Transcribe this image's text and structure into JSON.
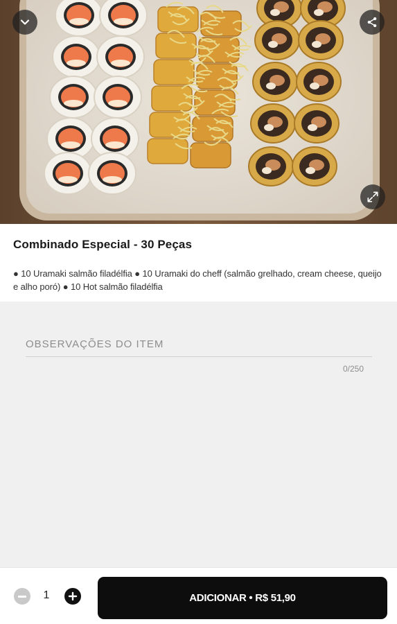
{
  "product": {
    "title": "Combinado Especial - 30 Peças",
    "description": "● 10 Uramaki salmão filadélfia ● 10 Uramaki do cheff (salmão grelhado, cream cheese, queijo e alho poró) ● 10 Hot salmão filadélfia"
  },
  "notes": {
    "label": "OBSERVAÇÕES DO ITEM",
    "counter": "0/250"
  },
  "order": {
    "quantity": "1",
    "add_label": "ADICIONAR • R$ 51,90"
  },
  "icons": {
    "collapse": "chevron-down-icon",
    "share": "share-icon",
    "expand": "expand-icon",
    "minus": "minus-icon",
    "plus": "plus-icon"
  },
  "colors": {
    "button": "#0d0d0d",
    "background": "#f0f0f0",
    "disabled_minus": "#c9c9c9"
  }
}
